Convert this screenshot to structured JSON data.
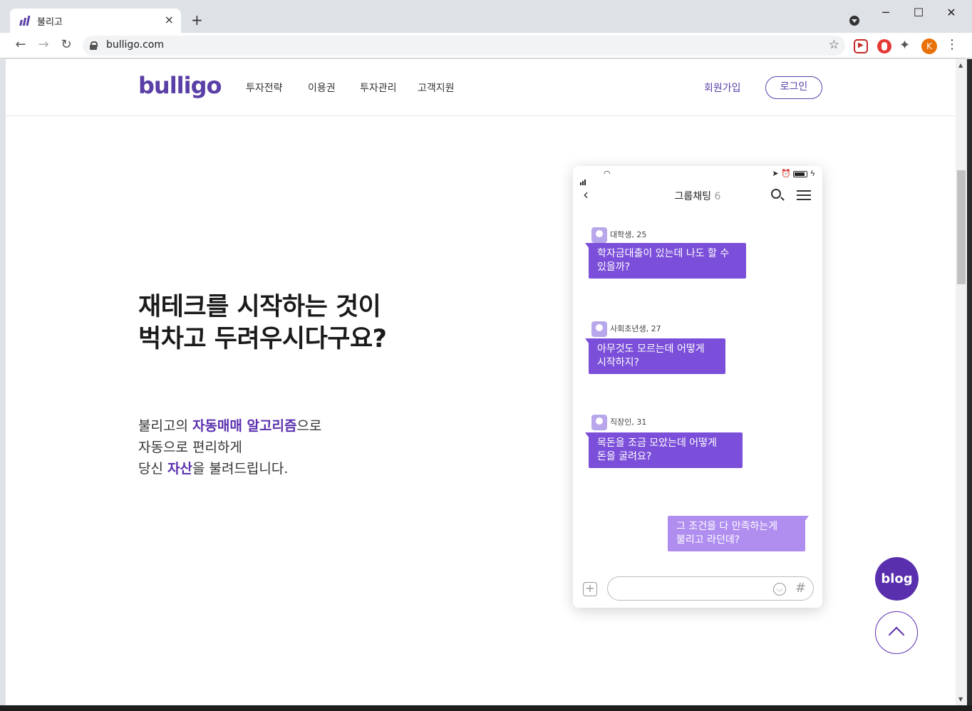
{
  "browser": {
    "tab_title": "불리고",
    "tab_close": "×",
    "new_tab": "+",
    "url": "bulligo.com",
    "profile_initial": "K",
    "win_min": "─",
    "win_max": "☐",
    "win_close": "✕"
  },
  "site": {
    "logo": "bulligo",
    "menu": [
      "투자전략",
      "이용권",
      "투자관리",
      "고객지원"
    ],
    "signup": "회원가입",
    "login": "로그인"
  },
  "hero": {
    "title_line1": "재테크를 시작하는 것이",
    "title_line2": "벅차고 두려우시다구요?",
    "desc_l1_a": "불리고의 ",
    "desc_l1_hl": "자동매매 알고리즘",
    "desc_l1_b": "으로",
    "desc_l2": "자동으로 편리하게",
    "desc_l3_a": "당신 ",
    "desc_l3_hl": "자산",
    "desc_l3_b": "을 불려드립니다."
  },
  "chat": {
    "title": "그룹채팅",
    "count": "6",
    "messages": [
      {
        "user": "대학생, 25",
        "line1": "학자금대출이 있는데 나도 할 수",
        "line2": "있을까?"
      },
      {
        "user": "사회초년생, 27",
        "line1": "아무것도 모르는데 어떻게",
        "line2": "시작하지?"
      },
      {
        "user": "직장인, 31",
        "line1": "목돈을 조금 모았는데 어떻게",
        "line2": "돈을 굴려요?"
      }
    ],
    "reply": {
      "line1": "그 조건을 다 만족하는게",
      "line2": "불리고 라던데?"
    }
  },
  "floating": {
    "blog": "blog"
  },
  "colors": {
    "brand": "#5a3fa6",
    "bubble": "#7b4fd9",
    "bubble_reply": "#b08ef0"
  }
}
